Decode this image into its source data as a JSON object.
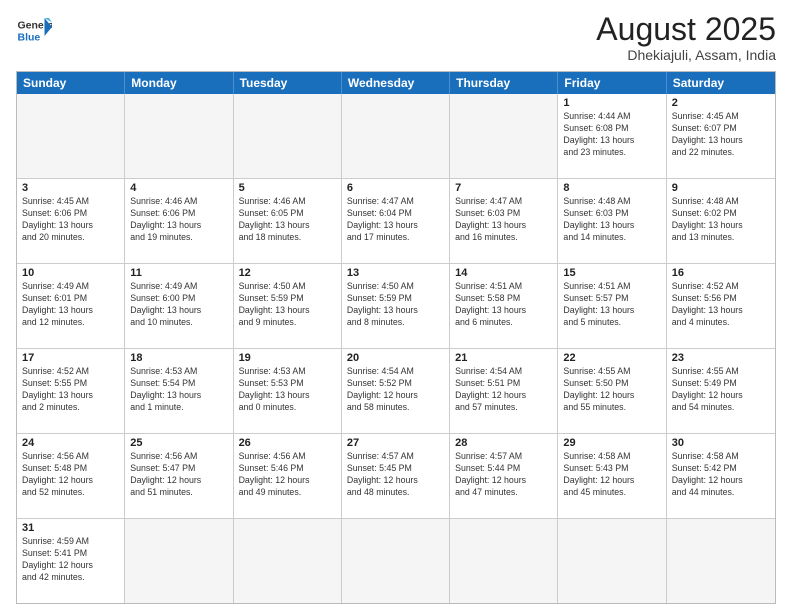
{
  "logo": {
    "line1": "General",
    "line2": "Blue"
  },
  "title": "August 2025",
  "location": "Dhekiajuli, Assam, India",
  "weekdays": [
    "Sunday",
    "Monday",
    "Tuesday",
    "Wednesday",
    "Thursday",
    "Friday",
    "Saturday"
  ],
  "weeks": [
    [
      {
        "day": "",
        "info": ""
      },
      {
        "day": "",
        "info": ""
      },
      {
        "day": "",
        "info": ""
      },
      {
        "day": "",
        "info": ""
      },
      {
        "day": "",
        "info": ""
      },
      {
        "day": "1",
        "info": "Sunrise: 4:44 AM\nSunset: 6:08 PM\nDaylight: 13 hours\nand 23 minutes."
      },
      {
        "day": "2",
        "info": "Sunrise: 4:45 AM\nSunset: 6:07 PM\nDaylight: 13 hours\nand 22 minutes."
      }
    ],
    [
      {
        "day": "3",
        "info": "Sunrise: 4:45 AM\nSunset: 6:06 PM\nDaylight: 13 hours\nand 20 minutes."
      },
      {
        "day": "4",
        "info": "Sunrise: 4:46 AM\nSunset: 6:06 PM\nDaylight: 13 hours\nand 19 minutes."
      },
      {
        "day": "5",
        "info": "Sunrise: 4:46 AM\nSunset: 6:05 PM\nDaylight: 13 hours\nand 18 minutes."
      },
      {
        "day": "6",
        "info": "Sunrise: 4:47 AM\nSunset: 6:04 PM\nDaylight: 13 hours\nand 17 minutes."
      },
      {
        "day": "7",
        "info": "Sunrise: 4:47 AM\nSunset: 6:03 PM\nDaylight: 13 hours\nand 16 minutes."
      },
      {
        "day": "8",
        "info": "Sunrise: 4:48 AM\nSunset: 6:03 PM\nDaylight: 13 hours\nand 14 minutes."
      },
      {
        "day": "9",
        "info": "Sunrise: 4:48 AM\nSunset: 6:02 PM\nDaylight: 13 hours\nand 13 minutes."
      }
    ],
    [
      {
        "day": "10",
        "info": "Sunrise: 4:49 AM\nSunset: 6:01 PM\nDaylight: 13 hours\nand 12 minutes."
      },
      {
        "day": "11",
        "info": "Sunrise: 4:49 AM\nSunset: 6:00 PM\nDaylight: 13 hours\nand 10 minutes."
      },
      {
        "day": "12",
        "info": "Sunrise: 4:50 AM\nSunset: 5:59 PM\nDaylight: 13 hours\nand 9 minutes."
      },
      {
        "day": "13",
        "info": "Sunrise: 4:50 AM\nSunset: 5:59 PM\nDaylight: 13 hours\nand 8 minutes."
      },
      {
        "day": "14",
        "info": "Sunrise: 4:51 AM\nSunset: 5:58 PM\nDaylight: 13 hours\nand 6 minutes."
      },
      {
        "day": "15",
        "info": "Sunrise: 4:51 AM\nSunset: 5:57 PM\nDaylight: 13 hours\nand 5 minutes."
      },
      {
        "day": "16",
        "info": "Sunrise: 4:52 AM\nSunset: 5:56 PM\nDaylight: 13 hours\nand 4 minutes."
      }
    ],
    [
      {
        "day": "17",
        "info": "Sunrise: 4:52 AM\nSunset: 5:55 PM\nDaylight: 13 hours\nand 2 minutes."
      },
      {
        "day": "18",
        "info": "Sunrise: 4:53 AM\nSunset: 5:54 PM\nDaylight: 13 hours\nand 1 minute."
      },
      {
        "day": "19",
        "info": "Sunrise: 4:53 AM\nSunset: 5:53 PM\nDaylight: 13 hours\nand 0 minutes."
      },
      {
        "day": "20",
        "info": "Sunrise: 4:54 AM\nSunset: 5:52 PM\nDaylight: 12 hours\nand 58 minutes."
      },
      {
        "day": "21",
        "info": "Sunrise: 4:54 AM\nSunset: 5:51 PM\nDaylight: 12 hours\nand 57 minutes."
      },
      {
        "day": "22",
        "info": "Sunrise: 4:55 AM\nSunset: 5:50 PM\nDaylight: 12 hours\nand 55 minutes."
      },
      {
        "day": "23",
        "info": "Sunrise: 4:55 AM\nSunset: 5:49 PM\nDaylight: 12 hours\nand 54 minutes."
      }
    ],
    [
      {
        "day": "24",
        "info": "Sunrise: 4:56 AM\nSunset: 5:48 PM\nDaylight: 12 hours\nand 52 minutes."
      },
      {
        "day": "25",
        "info": "Sunrise: 4:56 AM\nSunset: 5:47 PM\nDaylight: 12 hours\nand 51 minutes."
      },
      {
        "day": "26",
        "info": "Sunrise: 4:56 AM\nSunset: 5:46 PM\nDaylight: 12 hours\nand 49 minutes."
      },
      {
        "day": "27",
        "info": "Sunrise: 4:57 AM\nSunset: 5:45 PM\nDaylight: 12 hours\nand 48 minutes."
      },
      {
        "day": "28",
        "info": "Sunrise: 4:57 AM\nSunset: 5:44 PM\nDaylight: 12 hours\nand 47 minutes."
      },
      {
        "day": "29",
        "info": "Sunrise: 4:58 AM\nSunset: 5:43 PM\nDaylight: 12 hours\nand 45 minutes."
      },
      {
        "day": "30",
        "info": "Sunrise: 4:58 AM\nSunset: 5:42 PM\nDaylight: 12 hours\nand 44 minutes."
      }
    ],
    [
      {
        "day": "31",
        "info": "Sunrise: 4:59 AM\nSunset: 5:41 PM\nDaylight: 12 hours\nand 42 minutes."
      },
      {
        "day": "",
        "info": ""
      },
      {
        "day": "",
        "info": ""
      },
      {
        "day": "",
        "info": ""
      },
      {
        "day": "",
        "info": ""
      },
      {
        "day": "",
        "info": ""
      },
      {
        "day": "",
        "info": ""
      }
    ]
  ]
}
